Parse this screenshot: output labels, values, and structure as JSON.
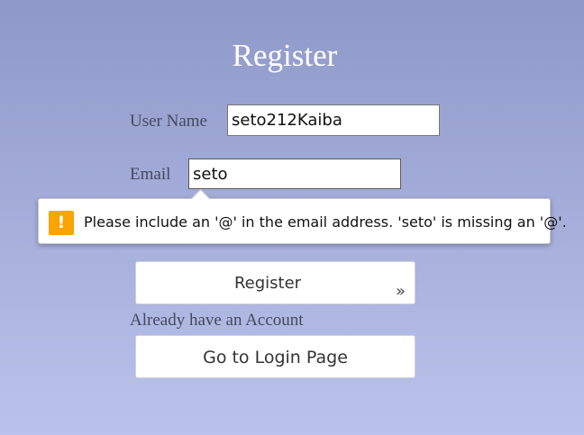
{
  "page": {
    "title": "Register"
  },
  "form": {
    "username": {
      "label": "User Name",
      "value": "seto212Kaiba"
    },
    "email": {
      "label": "Email",
      "value": "seto"
    }
  },
  "validation": {
    "message": "Please include an '@' in the email address. 'seto' is missing an '@'.",
    "icon": "warning-icon",
    "icon_glyph": "!",
    "icon_color": "#f9a400"
  },
  "actions": {
    "register_label": "Register",
    "register_chevron": "»",
    "login_prompt": "Already have an Account",
    "login_label": "Go to Login Page"
  }
}
